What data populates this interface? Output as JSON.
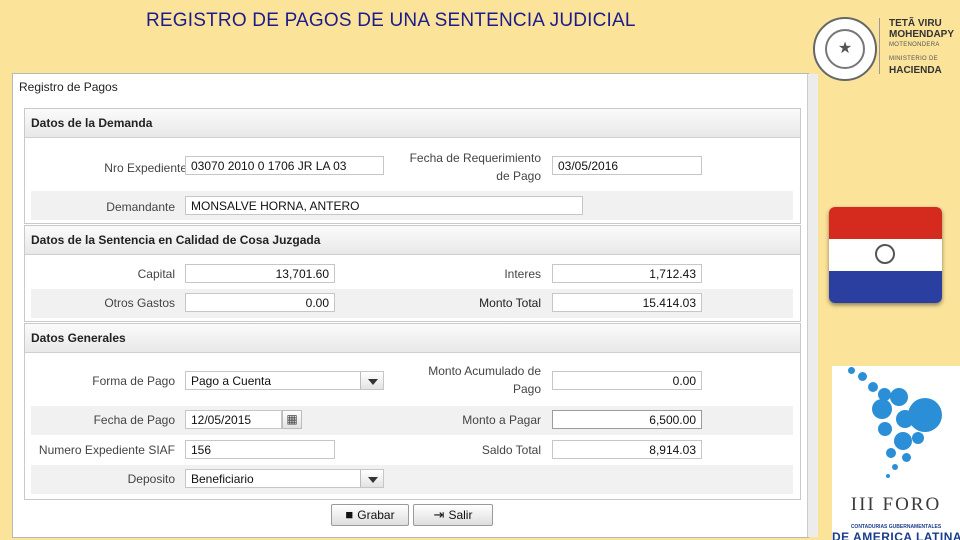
{
  "slide": {
    "title": "REGISTRO DE PAGOS DE UNA  SENTENCIA JUDICIAL"
  },
  "header_logo": {
    "line1": "TETÃ VIRU",
    "line2": "MOHENDAPY",
    "line3": "MOTENONDERA",
    "line4": "MINISTERIO DE",
    "line5": "HACIENDA"
  },
  "window": {
    "title": "Registro de Pagos"
  },
  "demanda": {
    "header": "Datos de la Demanda",
    "nro_expediente_label": "Nro Expediente",
    "nro_expediente_value": "03070 2010 0 1706 JR LA 03",
    "fecha_req_label_1": "Fecha de Requerimiento",
    "fecha_req_label_2": "de Pago",
    "fecha_req_value": "03/05/2016",
    "demandante_label": "Demandante",
    "demandante_value": "MONSALVE HORNA, ANTERO"
  },
  "sentencia": {
    "header": "Datos de la Sentencia en Calidad de Cosa Juzgada",
    "capital_label": "Capital",
    "capital_value": "13,701.60",
    "intereses_label": "Interes",
    "intereses_value": "1,712.43",
    "otros_label": "Otros Gastos",
    "otros_value": "0.00",
    "monto_total_label": "Monto Total",
    "monto_total_value": "15.414.03"
  },
  "generales": {
    "header": "Datos Generales",
    "forma_pago_label": "Forma de Pago",
    "forma_pago_value": "Pago a Cuenta",
    "monto_acum_label_1": "Monto Acumulado de",
    "monto_acum_label_2": "Pago",
    "monto_acum_value": "0.00",
    "fecha_pago_label": "Fecha de Pago",
    "fecha_pago_value": "12/05/2015",
    "monto_pagar_label": "Monto a Pagar",
    "monto_pagar_value": "6,500.00",
    "siaf_label": "Numero Expediente SIAF",
    "siaf_value": "156",
    "saldo_label": "Saldo Total",
    "saldo_value": "8,914.03",
    "deposito_label": "Deposito",
    "deposito_value": "Beneficiario"
  },
  "buttons": {
    "grabar": "Grabar",
    "salir": "Salir"
  },
  "icons": {
    "grabar": "save-icon",
    "salir": "exit-icon",
    "calendar": "calendar-icon",
    "dropdown": "chevron-down-icon"
  },
  "forum": {
    "title": "III FORO",
    "sub": "CONTADURIAS GUBERNAMENTALES",
    "bottom": "DE AMERICA LATINA"
  },
  "colors": {
    "slide_background": "#fbe39a",
    "title": "#1c1c8c",
    "forum_blue": "#2a8fd6",
    "flag_red": "#d52b1e",
    "flag_blue": "#2a3fa0"
  }
}
